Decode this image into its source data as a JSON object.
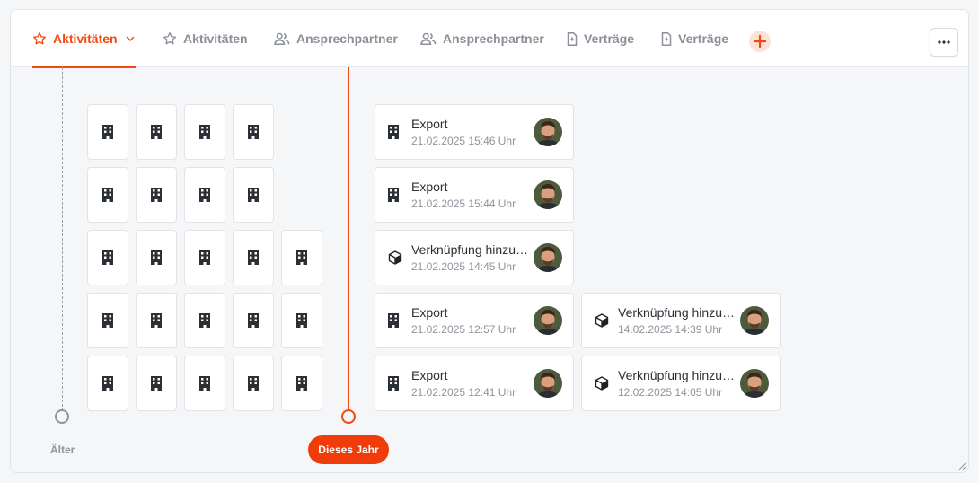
{
  "tabs": [
    {
      "label": "Aktivitäten",
      "icon": "star-icon",
      "active": true
    },
    {
      "label": "Aktivitäten",
      "icon": "star-icon",
      "active": false
    },
    {
      "label": "Ansprechpartner",
      "icon": "users-icon",
      "active": false
    },
    {
      "label": "Ansprechpartner",
      "icon": "users-icon",
      "active": false
    },
    {
      "label": "Verträge",
      "icon": "document-icon",
      "active": false
    },
    {
      "label": "Verträge",
      "icon": "document-icon",
      "active": false
    }
  ],
  "timeline": {
    "older_label": "Älter",
    "current_label": "Dieses Jahr"
  },
  "older_rows": [
    4,
    4,
    5,
    5,
    5
  ],
  "cards": [
    {
      "title": "Export",
      "time": "21.02.2025 15:46 Uhr",
      "icon": "building-icon"
    },
    {
      "title": "Export",
      "time": "21.02.2025 15:44 Uhr",
      "icon": "building-icon"
    },
    {
      "title": "Verknüpfung hinzugefügt",
      "time": "21.02.2025 14:45 Uhr",
      "icon": "cube-icon"
    },
    {
      "title": "Export",
      "time": "21.02.2025 12:57 Uhr",
      "icon": "building-icon"
    },
    {
      "title": "Verknüpfung hinzugefügt",
      "time": "14.02.2025 14:39 Uhr",
      "icon": "cube-icon"
    },
    {
      "title": "Export",
      "time": "21.02.2025 12:41 Uhr",
      "icon": "building-icon"
    },
    {
      "title": "Verknüpfung hinzugefügt",
      "time": "12.02.2025 14:05 Uhr",
      "icon": "cube-icon"
    }
  ],
  "colors": {
    "accent": "#f04a12",
    "muted": "#8f949c",
    "text": "#2b2f36"
  }
}
